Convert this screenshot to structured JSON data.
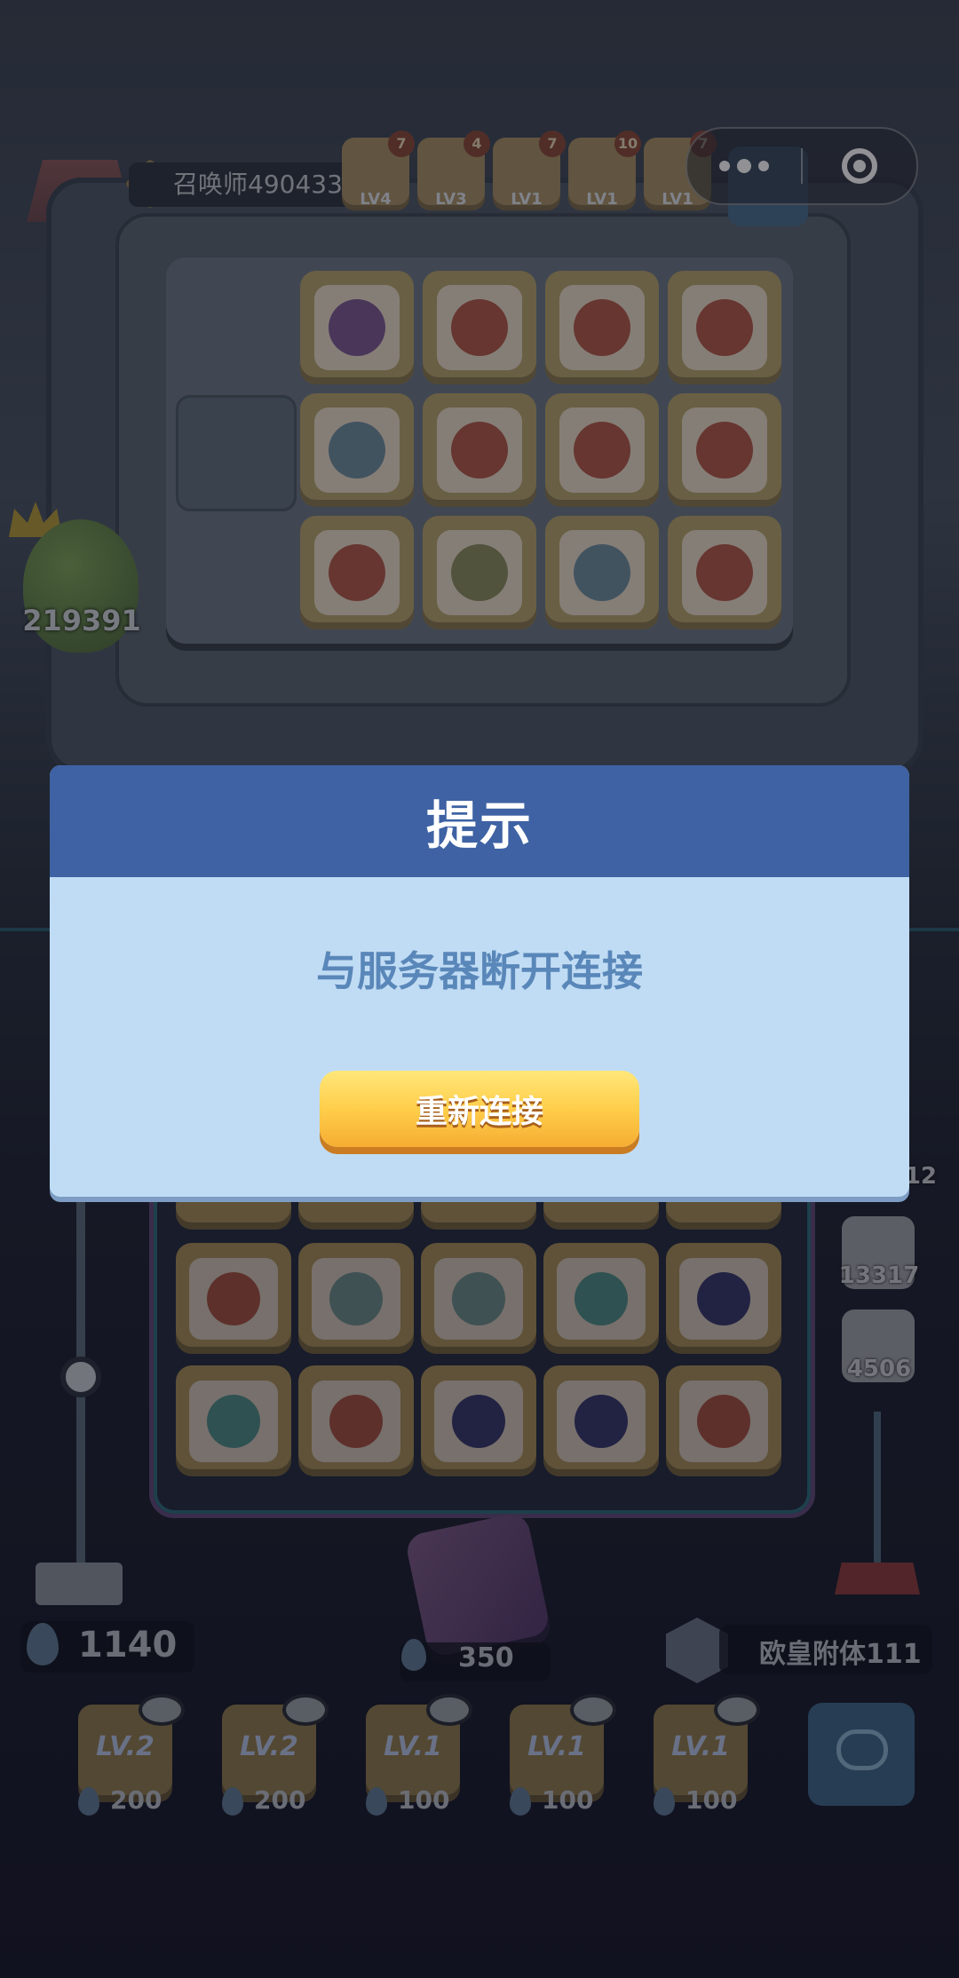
{
  "capsule": {
    "more_icon": "more-dots-icon",
    "close_icon": "mini-program-close-icon"
  },
  "opponent": {
    "name": "召唤师4904339",
    "boss_hp": "219391",
    "units": [
      {
        "lv": "LV4",
        "badge": "7"
      },
      {
        "lv": "LV3",
        "badge": "4"
      },
      {
        "lv": "LV1",
        "badge": "7"
      },
      {
        "lv": "LV1",
        "badge": "10"
      },
      {
        "lv": "LV1",
        "badge": "7"
      }
    ]
  },
  "player": {
    "name": "欧皇附体111",
    "energy": "1140",
    "dice_cost": "350",
    "right_hp": [
      "13317",
      "4506"
    ],
    "right_hp_partial": "12",
    "deck": [
      {
        "lv": "LV.2",
        "cost": "200"
      },
      {
        "lv": "LV.2",
        "cost": "200"
      },
      {
        "lv": "LV.1",
        "cost": "100"
      },
      {
        "lv": "LV.1",
        "cost": "100"
      },
      {
        "lv": "LV.1",
        "cost": "100"
      }
    ]
  },
  "dialog": {
    "title": "提示",
    "message": "与服务器断开连接",
    "button_label": "重新连接"
  },
  "colors": {
    "dialog_header": "#3e62a3",
    "dialog_body": "#c0dcf4",
    "message_text": "#5a87b9",
    "button_top": "#ffe77a",
    "button_bottom": "#f6ad32"
  }
}
